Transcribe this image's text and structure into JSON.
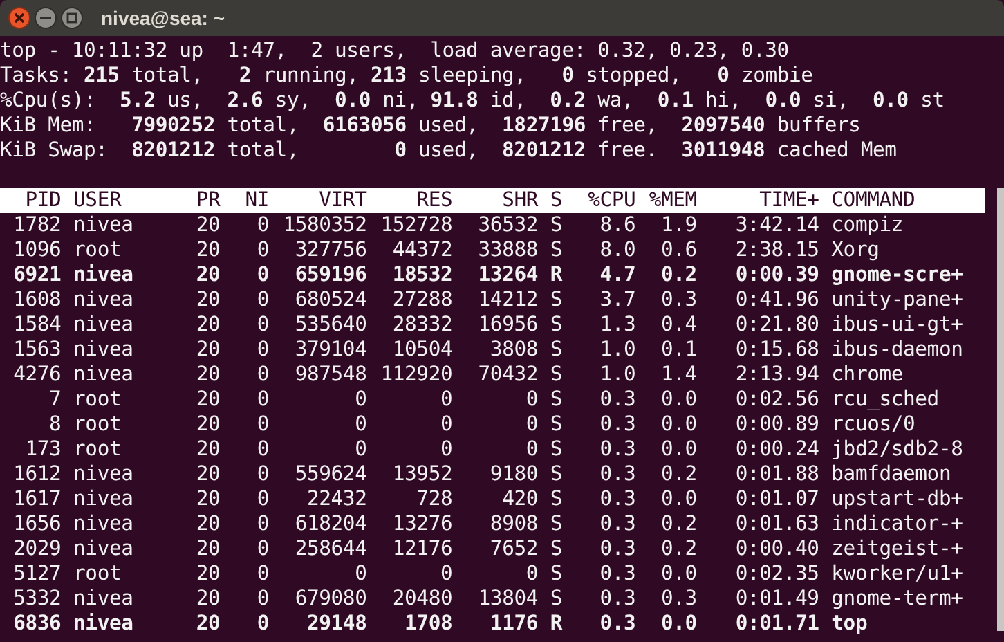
{
  "window": {
    "title": "nivea@sea: ~"
  },
  "summary": [
    "top - 10:11:32 up  1:47,  2 users,  load average: 0.32, 0.23, 0.30",
    "Tasks: **215** total,   **2** running, **213** sleeping,   **0** stopped,   **0** zombie",
    "%Cpu(s):  **5.2** us,  **2.6** sy,  **0.0** ni, **91.8** id,  **0.2** wa,  **0.1** hi,  **0.0** si,  **0.0** st",
    "KiB Mem:   **7990252** total,  **6163056** used,  **1827196** free,  **2097540** buffers",
    "KiB Swap:  **8201212** total,        **0** used,  **8201212** free.  **3011948** cached Mem"
  ],
  "table": {
    "columns": [
      "PID",
      "USER",
      "PR",
      "NI",
      "VIRT",
      "RES",
      "SHR",
      "S",
      "%CPU",
      "%MEM",
      "TIME+",
      "COMMAND"
    ],
    "rows": [
      {
        "highlighted": false,
        "cells": [
          "1782",
          "nivea",
          "20",
          "0",
          "1580352",
          "152728",
          "36532",
          "S",
          "8.6",
          "1.9",
          "3:42.14",
          "compiz"
        ]
      },
      {
        "highlighted": false,
        "cells": [
          "1096",
          "root",
          "20",
          "0",
          "327756",
          "44372",
          "33888",
          "S",
          "8.0",
          "0.6",
          "2:38.15",
          "Xorg"
        ]
      },
      {
        "highlighted": true,
        "cells": [
          "6921",
          "nivea",
          "20",
          "0",
          "659196",
          "18532",
          "13264",
          "R",
          "4.7",
          "0.2",
          "0:00.39",
          "gnome-scre+"
        ]
      },
      {
        "highlighted": false,
        "cells": [
          "1608",
          "nivea",
          "20",
          "0",
          "680524",
          "27288",
          "14212",
          "S",
          "3.7",
          "0.3",
          "0:41.96",
          "unity-pane+"
        ]
      },
      {
        "highlighted": false,
        "cells": [
          "1584",
          "nivea",
          "20",
          "0",
          "535640",
          "28332",
          "16956",
          "S",
          "1.3",
          "0.4",
          "0:21.80",
          "ibus-ui-gt+"
        ]
      },
      {
        "highlighted": false,
        "cells": [
          "1563",
          "nivea",
          "20",
          "0",
          "379104",
          "10504",
          "3808",
          "S",
          "1.0",
          "0.1",
          "0:15.68",
          "ibus-daemon"
        ]
      },
      {
        "highlighted": false,
        "cells": [
          "4276",
          "nivea",
          "20",
          "0",
          "987548",
          "112920",
          "70432",
          "S",
          "1.0",
          "1.4",
          "2:13.94",
          "chrome"
        ]
      },
      {
        "highlighted": false,
        "cells": [
          "7",
          "root",
          "20",
          "0",
          "0",
          "0",
          "0",
          "S",
          "0.3",
          "0.0",
          "0:02.56",
          "rcu_sched"
        ]
      },
      {
        "highlighted": false,
        "cells": [
          "8",
          "root",
          "20",
          "0",
          "0",
          "0",
          "0",
          "S",
          "0.3",
          "0.0",
          "0:00.89",
          "rcuos/0"
        ]
      },
      {
        "highlighted": false,
        "cells": [
          "173",
          "root",
          "20",
          "0",
          "0",
          "0",
          "0",
          "S",
          "0.3",
          "0.0",
          "0:00.24",
          "jbd2/sdb2-8"
        ]
      },
      {
        "highlighted": false,
        "cells": [
          "1612",
          "nivea",
          "20",
          "0",
          "559624",
          "13952",
          "9180",
          "S",
          "0.3",
          "0.2",
          "0:01.88",
          "bamfdaemon"
        ]
      },
      {
        "highlighted": false,
        "cells": [
          "1617",
          "nivea",
          "20",
          "0",
          "22432",
          "728",
          "420",
          "S",
          "0.3",
          "0.0",
          "0:01.07",
          "upstart-db+"
        ]
      },
      {
        "highlighted": false,
        "cells": [
          "1656",
          "nivea",
          "20",
          "0",
          "618204",
          "13276",
          "8908",
          "S",
          "0.3",
          "0.2",
          "0:01.63",
          "indicator-+"
        ]
      },
      {
        "highlighted": false,
        "cells": [
          "2029",
          "nivea",
          "20",
          "0",
          "258644",
          "12176",
          "7652",
          "S",
          "0.3",
          "0.2",
          "0:00.40",
          "zeitgeist-+"
        ]
      },
      {
        "highlighted": false,
        "cells": [
          "5127",
          "root",
          "20",
          "0",
          "0",
          "0",
          "0",
          "S",
          "0.3",
          "0.0",
          "0:02.35",
          "kworker/u1+"
        ]
      },
      {
        "highlighted": false,
        "cells": [
          "5332",
          "nivea",
          "20",
          "0",
          "679080",
          "20480",
          "13804",
          "S",
          "0.3",
          "0.3",
          "0:01.49",
          "gnome-term+"
        ]
      },
      {
        "highlighted": true,
        "cells": [
          "6836",
          "nivea",
          "20",
          "0",
          "29148",
          "1708",
          "1176",
          "R",
          "0.3",
          "0.0",
          "0:01.71",
          "top"
        ]
      }
    ]
  }
}
